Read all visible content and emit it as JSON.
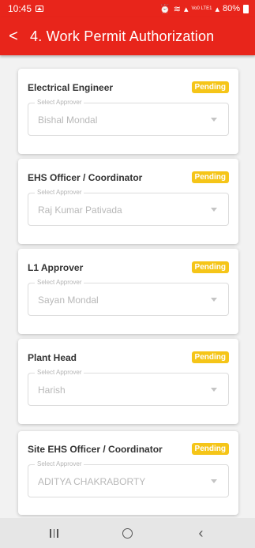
{
  "status_bar": {
    "time": "10:45",
    "icons_text": "Vo0 LTE1",
    "battery": "80%"
  },
  "app_bar": {
    "back_label": "<",
    "title": "4. Work Permit Authorization"
  },
  "cards": [
    {
      "title": "Electrical Engineer",
      "status": "Pending",
      "select_label": "Select Approver",
      "select_value": "Bishal Mondal"
    },
    {
      "title": "EHS Officer / Coordinator",
      "status": "Pending",
      "select_label": "Select Approver",
      "select_value": "Raj Kumar Pativada"
    },
    {
      "title": "L1 Approver",
      "status": "Pending",
      "select_label": "Select Approver",
      "select_value": "Sayan Mondal"
    },
    {
      "title": "Plant Head",
      "status": "Pending",
      "select_label": "Select Approver",
      "select_value": "Harish"
    },
    {
      "title": "Site EHS Officer / Coordinator",
      "status": "Pending",
      "select_label": "Select Approver",
      "select_value": "ADITYA CHAKRABORTY"
    }
  ],
  "colors": {
    "app_bar": "#e8251b",
    "badge": "#f5c518"
  },
  "nav": {
    "recents": "recents-icon",
    "home": "home-icon",
    "back": "back-icon"
  }
}
